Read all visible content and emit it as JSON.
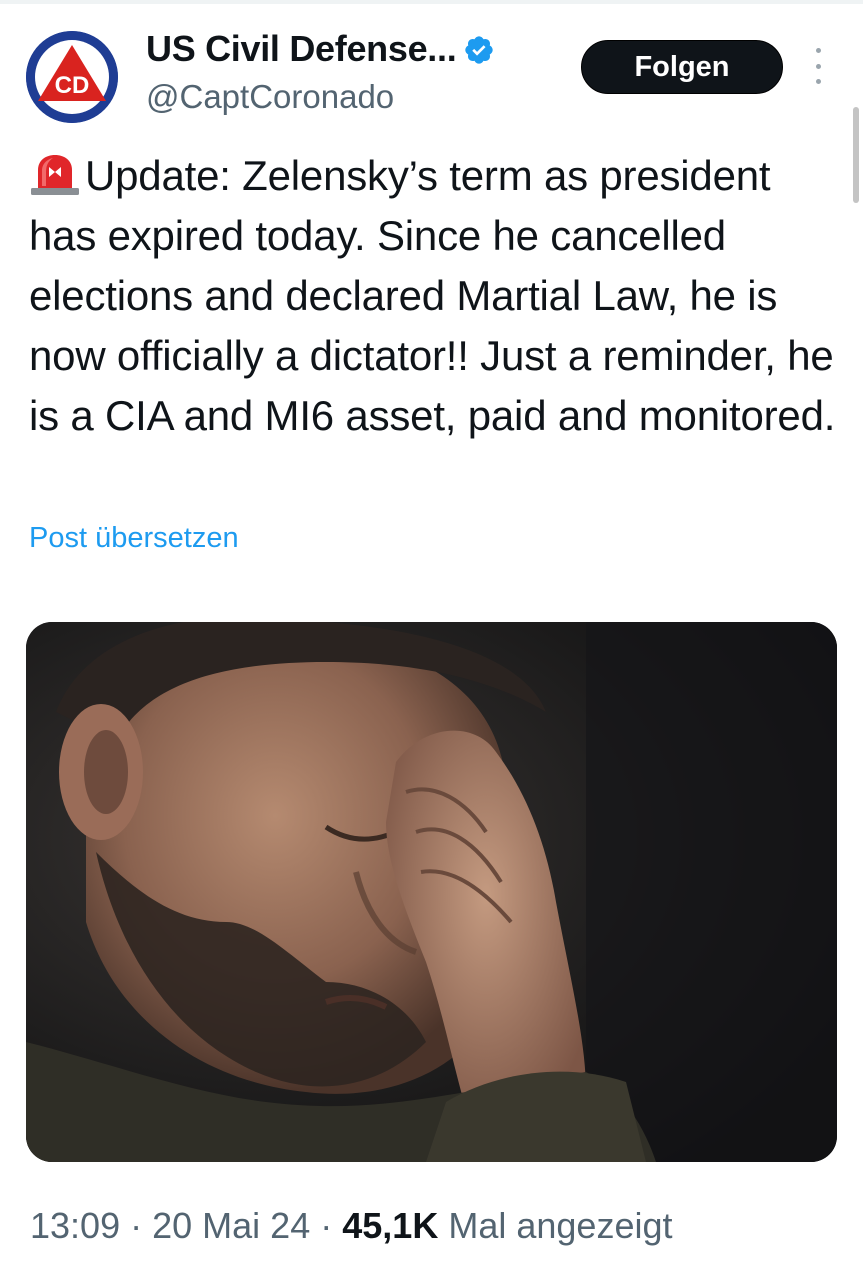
{
  "account": {
    "display_name": "US Civil Defense...",
    "handle": "@CaptCoronado",
    "avatar_letters": "CD",
    "verified": true
  },
  "follow_button": {
    "label": "Folgen"
  },
  "more_menu": {
    "icon": "more-vertical-icon"
  },
  "tweet": {
    "emoji": "rotating-light",
    "text": "Update: Zelensky’s term as president has expired today. Since he cancelled elections and declared Martial Law, he is now officially a dictator!! Just a reminder, he is a CIA and MI6 asset, paid and monitored.",
    "translate_link": "Post übersetzen"
  },
  "meta": {
    "time": "13:09",
    "separator": "·",
    "date": "20 Mai 24",
    "views_count": "45,1K",
    "views_label": "Mal angezeigt"
  },
  "colors": {
    "link": "#1d9bf0",
    "text": "#0f1419",
    "secondary": "#536471",
    "verified": "#1d9bf0"
  }
}
